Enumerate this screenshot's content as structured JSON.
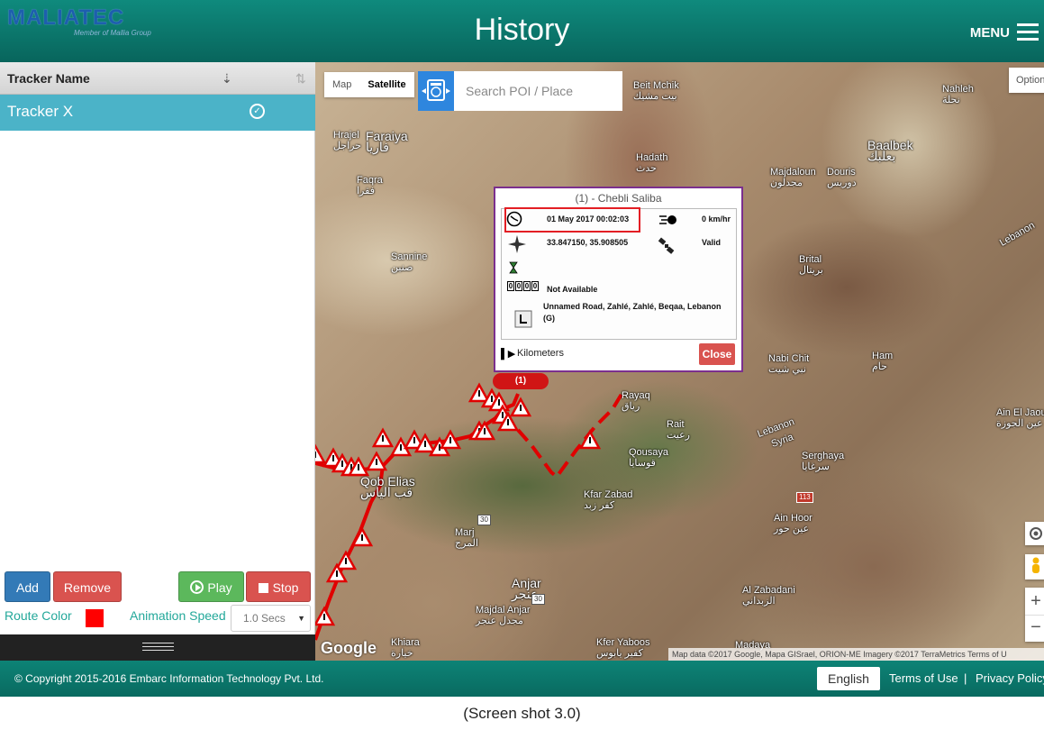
{
  "header": {
    "logo_text": "MALIATEC",
    "logo_sub": "Member of Mallia Group",
    "title": "History",
    "menu_label": "MENU"
  },
  "sidebar": {
    "column_header": "Tracker Name",
    "trackers": [
      {
        "name": "Tracker X",
        "selected": true
      }
    ],
    "buttons": {
      "add": "Add",
      "remove": "Remove",
      "play": "Play",
      "stop": "Stop"
    },
    "route_color_label": "Route Color",
    "route_color": "#ff0000",
    "animation_speed_label": "Animation Speed",
    "animation_speed_value": "1.0 Secs"
  },
  "map": {
    "type_buttons": {
      "map": "Map",
      "satellite": "Satellite"
    },
    "search_placeholder": "Search POI / Place",
    "options_label": "Option",
    "google_label": "Google",
    "attribution": "Map data ©2017 Google, Mapa GISrael, ORION-ME Imagery ©2017 TerraMetrics   Terms of U",
    "places": [
      {
        "name": "Beit Mchik",
        "ar": "بيت مشيك"
      },
      {
        "name": "Nahleh",
        "ar": "نحلة"
      },
      {
        "name": "Baalbek",
        "ar": "بعلبك"
      },
      {
        "name": "Hrajel",
        "ar": "حراجل"
      },
      {
        "name": "Faraiya",
        "ar": "فاريا"
      },
      {
        "name": "Hadath",
        "ar": "حدث"
      },
      {
        "name": "Majdaloun",
        "ar": "مجدلون"
      },
      {
        "name": "Douris",
        "ar": "دوريس"
      },
      {
        "name": "Faqra",
        "ar": "فقرا"
      },
      {
        "name": "Sannine",
        "ar": "صنين"
      },
      {
        "name": "Brital",
        "ar": "بريتال"
      },
      {
        "name": "Nabi Chit",
        "ar": "نبي شيت"
      },
      {
        "name": "Ham",
        "ar": "حام"
      },
      {
        "name": "Rayaq",
        "ar": "رياق"
      },
      {
        "name": "Rait",
        "ar": "رعيت"
      },
      {
        "name": "Ain El Jaou",
        "ar": "عين الجوزة"
      },
      {
        "name": "Qousaya",
        "ar": "قوسايا"
      },
      {
        "name": "Serghaya",
        "ar": "سرغايا"
      },
      {
        "name": "Qob Elias",
        "ar": "قب الياس"
      },
      {
        "name": "Kfar Zabad",
        "ar": "كفر زبد"
      },
      {
        "name": "Ain Hoor",
        "ar": "عين حور"
      },
      {
        "name": "Marj",
        "ar": "المرج"
      },
      {
        "name": "Anjar",
        "ar": "عنجر"
      },
      {
        "name": "Majdal Anjar",
        "ar": "مجدل عنجر"
      },
      {
        "name": "Al Zabadani",
        "ar": "الزبداني"
      },
      {
        "name": "Khiara",
        "ar": "خيارة"
      },
      {
        "name": "Kfer Yaboos",
        "ar": "كفير يابوس"
      },
      {
        "name": "Madaya",
        "ar": ""
      },
      {
        "name": "Lebanon",
        "ar": ""
      },
      {
        "name": "Syria",
        "ar": ""
      }
    ],
    "road_shields": [
      "30",
      "30",
      "113"
    ],
    "marker_label": "(1)",
    "popup": {
      "title": "(1) - Chebli Saliba",
      "datetime": "01 May 2017 00:02:03",
      "speed": "0 km/hr",
      "coords": "33.847150, 35.908505",
      "gps_status": "Valid",
      "odometer_digits": [
        "0",
        "0",
        "0",
        "0"
      ],
      "odometer_text": "Not Available",
      "address": "Unnamed Road, Zahlé, Zahlé, Beqaa, Lebanon (G)",
      "footer_label": "Kilometers",
      "close_label": "Close",
      "colors": {
        "border": "#7b2f8e",
        "highlight": "#e31e24"
      }
    }
  },
  "footer": {
    "copyright": "© Copyright 2015-2016 Embarc Information Technology Pvt. Ltd.",
    "language": "English",
    "terms": "Terms of Use",
    "separator": "|",
    "privacy": "Privacy Policy"
  },
  "caption": "(Screen shot 3.0)",
  "colors": {
    "header": "#0b7a6e",
    "tracker_row": "#4bb3c8",
    "add": "#337ab7",
    "danger": "#d9534f",
    "play": "#5cb85c",
    "label_teal": "#23a89a",
    "route": "#e00000"
  }
}
